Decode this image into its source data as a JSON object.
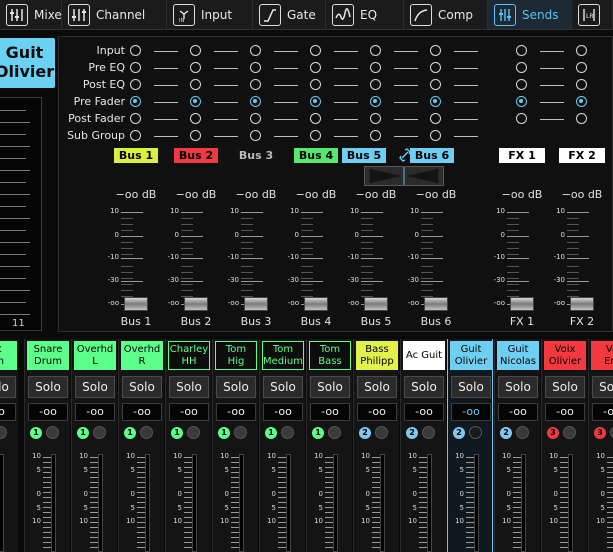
{
  "tabs": [
    {
      "label": "Mixer",
      "icon": "mixer-icon"
    },
    {
      "label": "Channel",
      "icon": "channel-icon"
    },
    {
      "label": "Input",
      "icon": "input-icon"
    },
    {
      "label": "Gate",
      "icon": "gate-icon"
    },
    {
      "label": "EQ",
      "icon": "eq-icon"
    },
    {
      "label": "Comp",
      "icon": "comp-icon"
    },
    {
      "label": "Sends",
      "icon": "sends-icon"
    },
    {
      "label": "",
      "icon": "lr-icon"
    }
  ],
  "selected_channel": {
    "label": "Guit Olivier",
    "line1": "Guit",
    "line2": "Olivier"
  },
  "left_scale": {
    "channel_number": "11"
  },
  "tap_points": [
    "Input",
    "Pre EQ",
    "Post EQ",
    "Pre Fader",
    "Post Fader",
    "Sub Group"
  ],
  "buses": [
    {
      "label": "Bus 1",
      "color": "#dcef3a",
      "db": "−oo dB",
      "name": "Bus 1",
      "selected_tap": "Pre Fader"
    },
    {
      "label": "Bus 2",
      "color": "#f1393f",
      "db": "−oo dB",
      "name": "Bus 2",
      "selected_tap": "Pre Fader"
    },
    {
      "label": "Bus 3",
      "color": "#111111",
      "db": "−oo dB",
      "name": "Bus 3",
      "selected_tap": "Pre Fader"
    },
    {
      "label": "Bus 4",
      "color": "#56e86e",
      "db": "−oo dB",
      "name": "Bus 4",
      "selected_tap": "Pre Fader"
    },
    {
      "label": "Bus 5",
      "color": "#6fcff3",
      "db": "−oo dB",
      "name": "Bus 5",
      "selected_tap": "Pre Fader"
    },
    {
      "label": "Bus 6",
      "color": "#6fcff3",
      "db": "−oo dB",
      "name": "Bus 6",
      "selected_tap": "Pre Fader"
    },
    {
      "label": "FX 1",
      "color": "#ffffff",
      "db": "−oo dB",
      "name": "FX 1",
      "selected_tap": "Pre Fader"
    },
    {
      "label": "FX 2",
      "color": "#ffffff",
      "db": "−oo dB",
      "name": "FX 2",
      "selected_tap": "Pre Fader"
    }
  ],
  "fader_scale": [
    "10",
    "0",
    "-10",
    "-30",
    "-oo"
  ],
  "channels": [
    {
      "name": "ck\num",
      "color": "#5dff8b",
      "style": "light",
      "solo": "Solo",
      "value": "-oo",
      "group": "1",
      "group_color": "#5dff8b"
    },
    {
      "name": "Snare\nDrum",
      "color": "#5dff8b",
      "style": "light",
      "solo": "Solo",
      "value": "-oo",
      "group": "1",
      "group_color": "#5dff8b"
    },
    {
      "name": "Overhd\nL",
      "color": "#5dff8b",
      "style": "light",
      "solo": "Solo",
      "value": "-oo",
      "group": "1",
      "group_color": "#5dff8b"
    },
    {
      "name": "Overhd\nR",
      "color": "#5dff8b",
      "style": "light",
      "solo": "Solo",
      "value": "-oo",
      "group": "1",
      "group_color": "#5dff8b"
    },
    {
      "name": "Charley\nHH",
      "color": "#5dff8b",
      "style": "dark",
      "solo": "Solo",
      "value": "-oo",
      "group": "1",
      "group_color": "#5dff8b"
    },
    {
      "name": "Tom Hig",
      "color": "#5dff8b",
      "style": "dark",
      "solo": "Solo",
      "value": "-oo",
      "group": "1",
      "group_color": "#5dff8b"
    },
    {
      "name": "Tom\nMedium",
      "color": "#5dff8b",
      "style": "dark",
      "solo": "Solo",
      "value": "-oo",
      "group": "1",
      "group_color": "#5dff8b"
    },
    {
      "name": "Tom\nBass",
      "color": "#5dff8b",
      "style": "dark",
      "solo": "Solo",
      "value": "-oo",
      "group": "1",
      "group_color": "#5dff8b"
    },
    {
      "name": "Bass\nPhilipp",
      "color": "#e2f24a",
      "style": "light",
      "solo": "Solo",
      "value": "-oo",
      "group": "2",
      "group_color": "#7fc8f0"
    },
    {
      "name": "Ac Guit",
      "color": "#ffffff",
      "style": "light",
      "solo": "Solo",
      "value": "-oo",
      "group": "2",
      "group_color": "#7fc8f0"
    },
    {
      "name": "Guit\nOlivier",
      "color": "#6fcff3",
      "style": "light",
      "solo": "Solo",
      "value": "-oo",
      "group": "2",
      "group_color": "#7fc8f0",
      "selected": true
    },
    {
      "name": "Guit\nNicolas",
      "color": "#6fcff3",
      "style": "light",
      "solo": "Solo",
      "value": "-oo",
      "group": "2",
      "group_color": "#7fc8f0"
    },
    {
      "name": "Voix\nOlivier",
      "color": "#f1393f",
      "style": "light",
      "solo": "Solo",
      "value": "-oo",
      "group": "3",
      "group_color": "#f1393f"
    },
    {
      "name": "Vo\nEm",
      "color": "#f1393f",
      "style": "light",
      "solo": "Solo",
      "value": "-oo",
      "group": "3",
      "group_color": "#f1393f"
    }
  ],
  "mini_scale": [
    "10",
    "5",
    "0",
    "5",
    "10"
  ]
}
